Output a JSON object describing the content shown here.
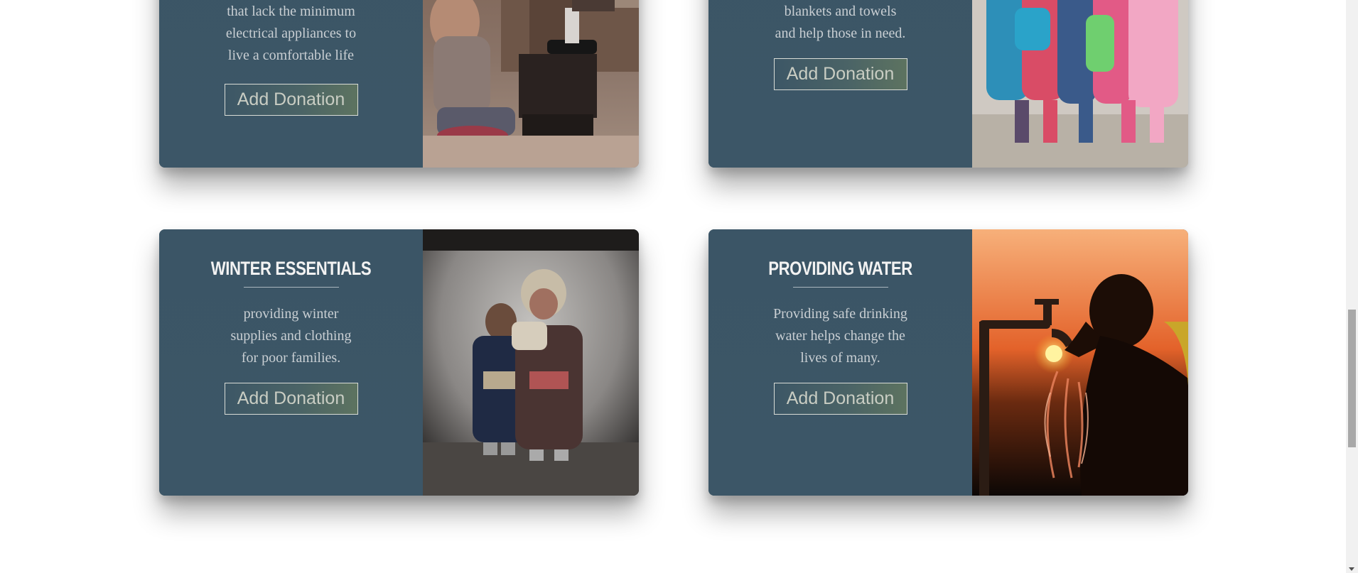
{
  "cards": [
    {
      "title": "",
      "description": [
        "that lack the minimum",
        "electrical appliances to",
        "live a comfortable life"
      ],
      "button_label": "Add Donation",
      "photo_icon": "shoe-shine-child-photo"
    },
    {
      "title": "",
      "description": [
        "blankets and towels",
        "and help those in need."
      ],
      "button_label": "Add Donation",
      "photo_icon": "children-with-toys-photo"
    },
    {
      "title": "WINTER ESSENTIALS",
      "description": [
        "providing winter",
        "supplies and clothing",
        "for poor families."
      ],
      "button_label": "Add Donation",
      "photo_icon": "children-winter-clothes-photo"
    },
    {
      "title": "PROVIDING WATER",
      "description": [
        "Providing safe drinking",
        "water helps change the",
        "lives of many."
      ],
      "button_label": "Add Donation",
      "photo_icon": "child-drinking-tap-water-photo"
    }
  ],
  "colors": {
    "card_bg": "#3b5566",
    "title": "#f2f2f2",
    "text": "#c9cfd3",
    "page_bg": "#ffffff"
  }
}
